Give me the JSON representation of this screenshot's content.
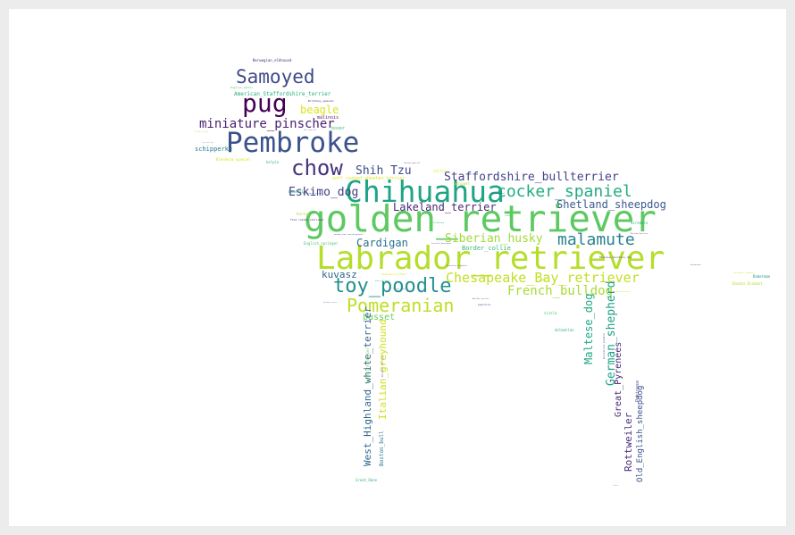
{
  "chart_data": {
    "type": "wordcloud",
    "title": "",
    "shape": "dog silhouette",
    "colormap": "viridis",
    "words": [
      {
        "text": "golden_retriever",
        "rank": 1,
        "color": "#5ec962"
      },
      {
        "text": "Labrador_retriever",
        "rank": 2,
        "color": "#b5de2b"
      },
      {
        "text": "Chihuahua",
        "rank": 3,
        "color": "#20a486"
      },
      {
        "text": "Pembroke",
        "rank": 4,
        "color": "#3b528b"
      },
      {
        "text": "pug",
        "rank": 5,
        "color": "#440154"
      },
      {
        "text": "Samoyed",
        "rank": 6,
        "color": "#3e4a89"
      },
      {
        "text": "chow",
        "rank": 7,
        "color": "#46327e"
      },
      {
        "text": "toy_poodle",
        "rank": 8,
        "color": "#21918c"
      },
      {
        "text": "Pomeranian",
        "rank": 9,
        "color": "#bddf26"
      },
      {
        "text": "malamute",
        "rank": 10,
        "color": "#26828e"
      },
      {
        "text": "cocker_spaniel",
        "rank": 11,
        "color": "#25ab82"
      },
      {
        "text": "Chesapeake_Bay_retriever",
        "rank": 12,
        "color": "#c2df23"
      },
      {
        "text": "miniature_pinscher",
        "rank": 13,
        "color": "#481f70"
      },
      {
        "text": "Siberian_husky",
        "rank": 14,
        "color": "#a2da37"
      },
      {
        "text": "French_bulldog",
        "rank": 15,
        "color": "#a8db34"
      },
      {
        "text": "Staffordshire_bullterrier",
        "rank": 16,
        "color": "#414487"
      },
      {
        "text": "Shih Tzu",
        "rank": 17,
        "color": "#3e4989"
      },
      {
        "text": "Eskimo_dog",
        "rank": 18,
        "color": "#424086"
      },
      {
        "text": "Lakeland_terrier",
        "rank": 19,
        "color": "#482677"
      },
      {
        "text": "Shetland_sheepdog",
        "rank": 20,
        "color": "#38598c"
      },
      {
        "text": "Cardigan",
        "rank": 21,
        "color": "#2c728e"
      },
      {
        "text": "beagle",
        "rank": 22,
        "color": "#dde318"
      },
      {
        "text": "kuvasz",
        "rank": 23,
        "color": "#33638d"
      },
      {
        "text": "basset",
        "rank": 24,
        "color": "#6ccd5a"
      },
      {
        "text": "German_shepherd",
        "rank": 25,
        "color": "#1fa188"
      },
      {
        "text": "Maltese_dog",
        "rank": 26,
        "color": "#22a884"
      },
      {
        "text": "West_Highland_white_terrier",
        "rank": 27,
        "color": "#31688e"
      },
      {
        "text": "Italian_greyhound",
        "rank": 28,
        "color": "#d0e11c"
      },
      {
        "text": "Rottweiler",
        "rank": 29,
        "color": "#472d7b"
      },
      {
        "text": "Great_Pyrenees",
        "rank": 30,
        "color": "#482173"
      },
      {
        "text": "Old_English_sheepdog",
        "rank": 31,
        "color": "#3b528b"
      },
      {
        "text": "Border_collie",
        "rank": 32,
        "color": "#35b779"
      },
      {
        "text": "schipperke",
        "rank": 33,
        "color": "#2a788e"
      },
      {
        "text": "boxer",
        "rank": 34,
        "color": "#3aba76"
      },
      {
        "text": "malinois",
        "rank": 35,
        "color": "#65156e"
      },
      {
        "text": "American_Staffordshire_terrier",
        "rank": 36,
        "color": "#29af7f"
      },
      {
        "text": "Norwegian_elkhound",
        "rank": 37,
        "color": "#472c7a"
      },
      {
        "text": "English_setter",
        "rank": 38,
        "color": "#52c569"
      },
      {
        "text": "Brittany_spaniel",
        "rank": 39,
        "color": "#481668"
      },
      {
        "text": "Blenheim_spaniel",
        "rank": 40,
        "color": "#d8e219"
      },
      {
        "text": "kelpie",
        "rank": 41,
        "color": "#3dbc74"
      },
      {
        "text": "soft coated_wheaten_terrier",
        "rank": 42,
        "color": "#e5e419"
      },
      {
        "text": "collie",
        "rank": 43,
        "color": "#dde318"
      },
      {
        "text": "whippet",
        "rank": 44,
        "color": "#b8de29"
      },
      {
        "text": "basenji",
        "rank": 45,
        "color": "#1e9c89"
      },
      {
        "text": "Bedlington_terrier",
        "rank": 46,
        "color": "#2c728e"
      },
      {
        "text": "borzoi",
        "rank": 47,
        "color": "#b5de2b"
      },
      {
        "text": "flat coated_retriever",
        "rank": 48,
        "color": "#471365"
      },
      {
        "text": "German_short haired_pointer",
        "rank": 49,
        "color": "#3e4c8a"
      },
      {
        "text": "English_springer",
        "rank": 50,
        "color": "#4ac16d"
      },
      {
        "text": "Airedale",
        "rank": 51,
        "color": "#2db27d"
      },
      {
        "text": "Bernese_mountain_dog",
        "rank": 52,
        "color": "#5c3c89"
      },
      {
        "text": "Mexican_hairless",
        "rank": 53,
        "color": "#7a3a8a"
      },
      {
        "text": "standard_poodle",
        "rank": 54,
        "color": "#d2e21b"
      },
      {
        "text": "Saint_Bernard",
        "rank": 55,
        "color": "#2ab07f"
      },
      {
        "text": "bloodhound",
        "rank": 56,
        "color": "#2ab07f"
      },
      {
        "text": "Scottish_deerhound",
        "rank": 57,
        "color": "#6a3f8c"
      },
      {
        "text": "Newfoundland",
        "rank": 58,
        "color": "#3a5c8c"
      },
      {
        "text": "Tibetan_mastiff",
        "rank": 59,
        "color": "#4b3a80"
      },
      {
        "text": "redbone",
        "rank": 60,
        "color": "#3bbb75"
      },
      {
        "text": "papillon",
        "rank": 61,
        "color": "#38598c"
      },
      {
        "text": "Norfolk_terrier",
        "rank": 62,
        "color": "#3e4a89"
      },
      {
        "text": "vizsla",
        "rank": 63,
        "color": "#4ac16d"
      },
      {
        "text": "dalmatian",
        "rank": 64,
        "color": "#35b779"
      },
      {
        "text": "miniature_poodle",
        "rank": 65,
        "color": "#5b4b8e"
      },
      {
        "text": "Pekinese",
        "rank": 66,
        "color": "#5a4a8c"
      },
      {
        "text": "Yorkshire_terrier",
        "rank": 67,
        "color": "#7ad151"
      },
      {
        "text": "Boston_bull",
        "rank": 68,
        "color": "#2a788e"
      },
      {
        "text": "Border_terrier",
        "rank": 69,
        "color": "#7a5c9c"
      },
      {
        "text": "Great_Dane",
        "rank": 70,
        "color": "#35b779"
      },
      {
        "text": "Irish_terrier",
        "rank": 71,
        "color": "#9fda3a"
      },
      {
        "text": "Doberman",
        "rank": 72,
        "color": "#21918c"
      },
      {
        "text": "Dandie_Dinmont",
        "rank": 73,
        "color": "#b5de2b"
      },
      {
        "text": "miniature_schnauzer",
        "rank": 74,
        "color": "#c8e020"
      },
      {
        "text": "Weimaraner",
        "rank": 75,
        "color": "#6a5a9a"
      },
      {
        "text": "toy_terrier",
        "rank": 76,
        "color": "#9a86b8"
      },
      {
        "text": "Ibizan_hound",
        "rank": 77,
        "color": "#7a6aa8"
      },
      {
        "text": "bull_mastiff",
        "rank": 78,
        "color": "#7a6aa8"
      },
      {
        "text": "chow_small",
        "rank": 79,
        "color": "#6a6aa8"
      },
      {
        "text": "Lhasa",
        "rank": 80,
        "color": "#7ad151"
      },
      {
        "text": "Rhodesian_ridgeback",
        "rank": 81,
        "color": "#6a5a9a"
      },
      {
        "text": "keeshond",
        "rank": 82,
        "color": "#d0e11c"
      },
      {
        "text": "Gordon_setter",
        "rank": 83,
        "color": "#7a6aa8"
      },
      {
        "text": "Sealyham_terrier",
        "rank": 84,
        "color": "#b5de2b"
      }
    ]
  }
}
